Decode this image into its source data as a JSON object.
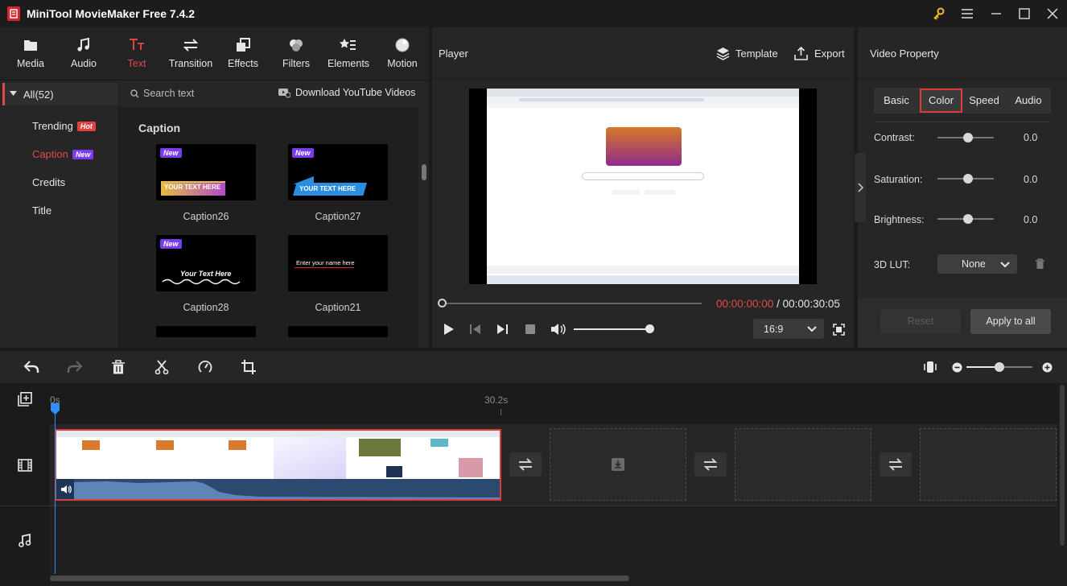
{
  "app": {
    "title": "MiniTool MovieMaker Free 7.4.2"
  },
  "toolbar": {
    "items": [
      {
        "label": "Media",
        "icon": "folder-icon"
      },
      {
        "label": "Audio",
        "icon": "music-note-icon"
      },
      {
        "label": "Text",
        "icon": "text-icon",
        "active": true
      },
      {
        "label": "Transition",
        "icon": "swap-arrows-icon"
      },
      {
        "label": "Effects",
        "icon": "layers-icon"
      },
      {
        "label": "Filters",
        "icon": "circles-icon"
      },
      {
        "label": "Elements",
        "icon": "shapes-icon"
      },
      {
        "label": "Motion",
        "icon": "sphere-icon"
      }
    ]
  },
  "categories": {
    "all": "All(52)",
    "items": [
      {
        "label": "Trending",
        "badge": "Hot"
      },
      {
        "label": "Caption",
        "badge": "New",
        "active": true
      },
      {
        "label": "Credits"
      },
      {
        "label": "Title"
      }
    ]
  },
  "search": {
    "placeholder": "Search text",
    "download_label": "Download YouTube Videos"
  },
  "content": {
    "section_title": "Caption",
    "captions": [
      {
        "name": "Caption26",
        "badge": "New",
        "preview_text": "YOUR TEXT HERE"
      },
      {
        "name": "Caption27",
        "badge": "New",
        "preview_text": "YOUR TEXT HERE"
      },
      {
        "name": "Caption28",
        "badge": "New",
        "preview_text": "Your Text Here"
      },
      {
        "name": "Caption21",
        "badge": "",
        "preview_text": "Enter your name here"
      }
    ]
  },
  "player": {
    "title": "Player",
    "template_label": "Template",
    "export_label": "Export",
    "current_time": "00:00:00:00",
    "separator": " / ",
    "total_time": "00:00:30:05",
    "aspect": "16:9",
    "progress": 0,
    "volume": 1.0
  },
  "video_property": {
    "title": "Video Property",
    "tabs": [
      "Basic",
      "Color",
      "Speed",
      "Audio"
    ],
    "active_tab": "Color",
    "contrast_label": "Contrast:",
    "contrast_value": "0.0",
    "saturation_label": "Saturation:",
    "saturation_value": "0.0",
    "brightness_label": "Brightness:",
    "brightness_value": "0.0",
    "lut_label": "3D LUT:",
    "lut_value": "None",
    "reset_label": "Reset",
    "apply_label": "Apply to all"
  },
  "timeline": {
    "ruler_start": "0s",
    "ruler_mark": "30.2s",
    "zoom": 0.5
  },
  "colors": {
    "accent": "#e14848",
    "new_badge": "#7a3cf0",
    "hot_badge": "#e04242",
    "selection": "#e03a3a"
  }
}
